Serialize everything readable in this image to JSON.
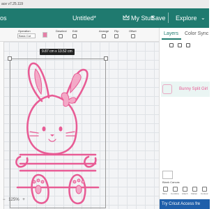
{
  "titlebar": {
    "text": "ace  v7.25.119"
  },
  "header": {
    "left_label": "os",
    "doc_title": "Untitled*",
    "mystuff": "My Stuff",
    "save": "Save",
    "explore": "Explore",
    "explore_chevron": "⌄"
  },
  "toolbar": {
    "operation_label": "Operation",
    "operation_value": "Basic Cut",
    "deselect_label": "Deselect",
    "edit_label": "Edit",
    "arrange_label": "Arrange",
    "flip_label": "Flip",
    "offset_label": "Offset"
  },
  "canvas": {
    "dimension": "9.87  cm x 13.52  cm",
    "zoom": "125%",
    "zoom_minus": "−",
    "zoom_plus": "+",
    "accent": "#e85c95"
  },
  "panel": {
    "tab_layers": "Layers",
    "tab_color_sync": "Color Sync",
    "layer_name": "Bunny Split Girl",
    "blank_canvas": "Blank Canvas",
    "bottom": [
      "Slice",
      "Combine",
      "Attach",
      "Flatten",
      "Contour"
    ],
    "promo": "Try Cricut Access fre"
  },
  "colors": {
    "header": "#1f7a6f",
    "pink": "#e85c95"
  }
}
